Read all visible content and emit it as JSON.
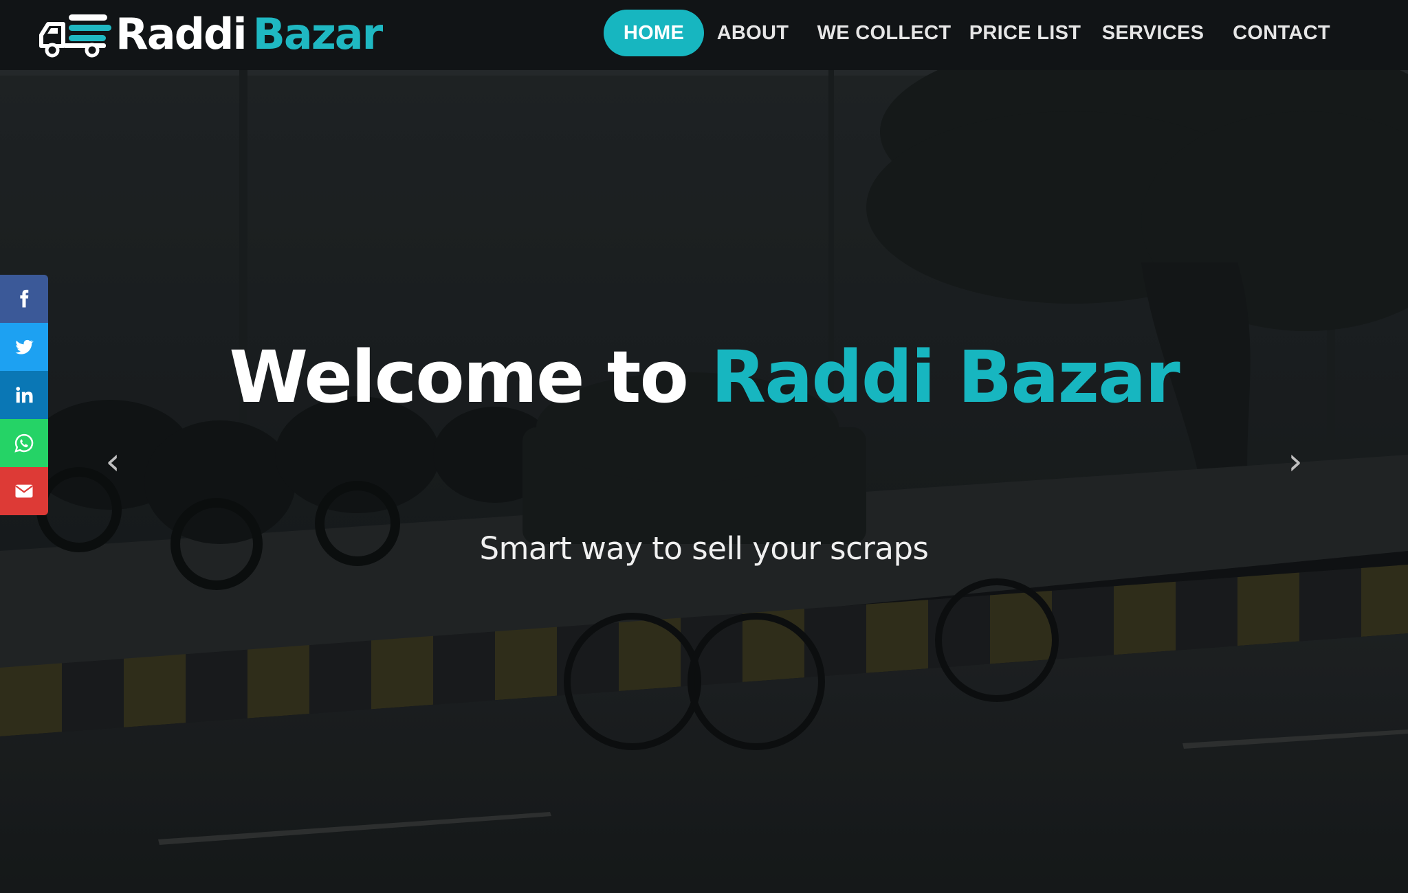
{
  "brand": {
    "name_part1": "Raddi",
    "name_part2": "Bazar",
    "accent_color": "#17b6c0",
    "logo_icon": "delivery-truck-icon"
  },
  "nav": {
    "items": [
      {
        "label": "HOME",
        "active": true
      },
      {
        "label": "ABOUT",
        "active": false
      },
      {
        "label": "WE COLLECT",
        "active": false
      },
      {
        "label": "PRICE LIST",
        "active": false
      },
      {
        "label": "SERVICES",
        "active": false
      },
      {
        "label": "CONTACT",
        "active": false
      }
    ]
  },
  "hero": {
    "title_prefix": "Welcome to ",
    "title_accent": "Raddi Bazar",
    "subtitle": "Smart way to sell your scraps",
    "prev_arrow": "‹",
    "next_arrow": "›"
  },
  "social": [
    {
      "name": "facebook-icon",
      "color": "#3b5998"
    },
    {
      "name": "twitter-icon",
      "color": "#1da1f2"
    },
    {
      "name": "linkedin-icon",
      "color": "#0a77b5"
    },
    {
      "name": "whatsapp-icon",
      "color": "#25d366"
    },
    {
      "name": "email-icon",
      "color": "#dd3a36"
    }
  ]
}
